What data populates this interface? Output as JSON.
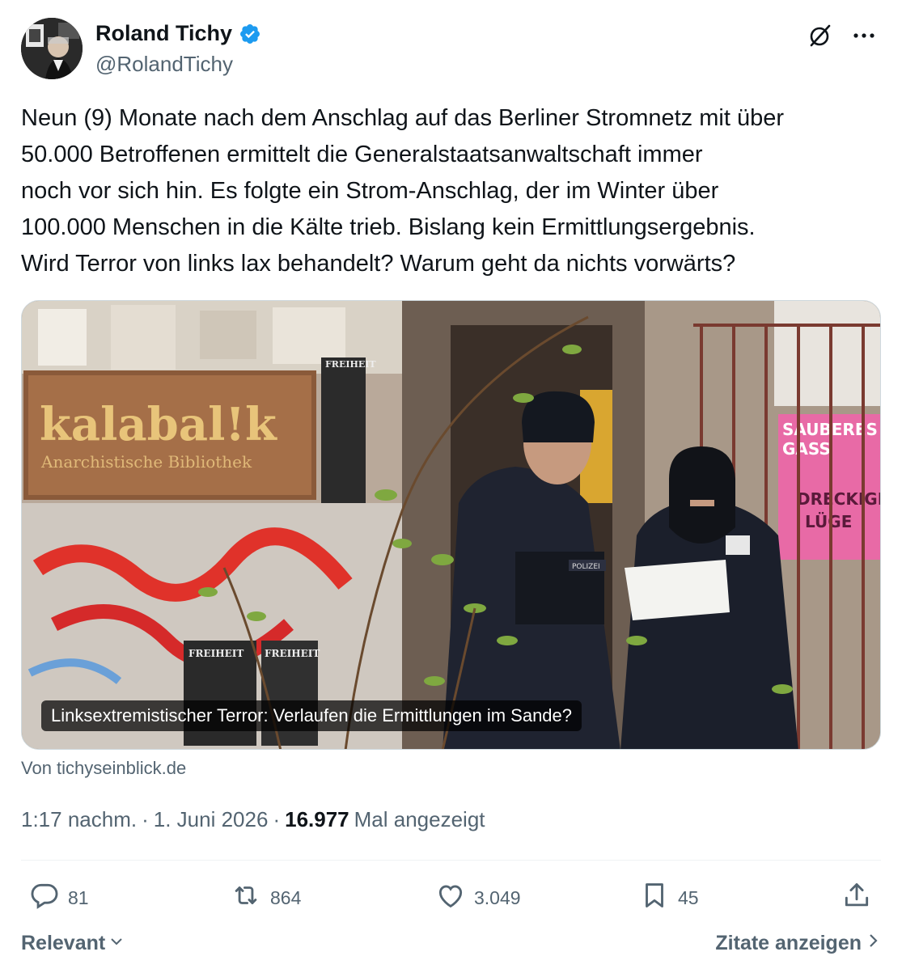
{
  "author": {
    "name": "Roland Tichy",
    "handle": "@RolandTichy",
    "verified": true
  },
  "tweet": {
    "text": "Neun (9) Monate nach dem Anschlag auf das Berliner Stromnetz mit über\n50.000 Betroffenen ermittelt die Generalstaatsanwaltschaft immer\nnoch vor sich hin. Es folgte ein Strom-Anschlag, der im Winter über\n100.000 Menschen in die Kälte trieb. Bislang kein Ermittlungsergebnis.\nWird Terror von links lax behandelt? Warum geht da nichts vorwärts?"
  },
  "card": {
    "caption": "Linksextremistischer Terror: Verlaufen die Ermittlungen im Sande?",
    "sign_main": "kalabal!k",
    "sign_sub": "Anarchistische Bibliothek",
    "poster_top": "FREIHEIT",
    "poster_bottom_left": "FREIHEIT",
    "poster_bottom_right": "FREIHEIT",
    "pink_poster_line1": "SAUBERES",
    "pink_poster_line2": "GASS",
    "pink_poster_line3": "DRECKIGE",
    "pink_poster_line4": "LÜGE",
    "vest_label": "POLIZEI",
    "source": "Von tichyseinblick.de"
  },
  "meta": {
    "time": "1:17 nachm.",
    "separator": "·",
    "date": "1. Juni 2026",
    "views": "16.977",
    "views_label": "Mal angezeigt"
  },
  "actions": {
    "replies": "81",
    "reposts": "864",
    "likes": "3.049",
    "bookmarks": "45"
  },
  "footer": {
    "sort_label": "Relevant",
    "quotes_label": "Zitate anzeigen"
  },
  "colors": {
    "verified_blue": "#1d9bf0",
    "muted": "#536471",
    "text": "#0f1419"
  },
  "icons": [
    "grok-icon",
    "more-icon",
    "reply-icon",
    "repost-icon",
    "like-icon",
    "bookmark-icon",
    "share-icon",
    "chevron-down-icon",
    "chevron-right-icon",
    "verified-badge-icon"
  ]
}
